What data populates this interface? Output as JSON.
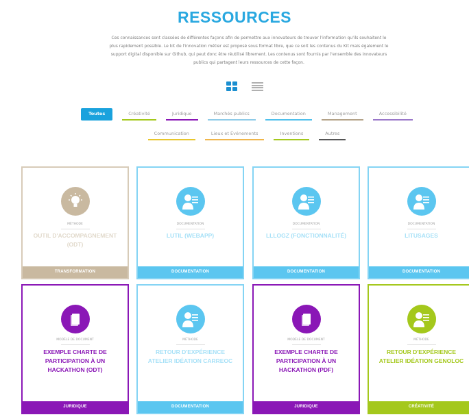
{
  "page": {
    "title": "RESSOURCES",
    "intro": "Ces connaissances sont classées de différentes façons afin de permettre aux innovateurs de trouver l'information qu'ils souhaitent le plus rapidement possible. Le kit de l'innovation métier est proposé sous format libre, que ce soit les contenus du Kit mais également le support digital disponible sur Github, qui peut donc être réutilisé librement. Les contenus sont fournis par l'ensemble des innovateurs publics qui partagent leurs ressources de cette façon."
  },
  "view_toggle": {
    "grid_icon": "grid-view-icon",
    "list_icon": "list-view-icon"
  },
  "filters": [
    {
      "label": "Toutes",
      "active": true,
      "color": "#1aa2dd"
    },
    {
      "label": "Créativité",
      "color": "#a4c81c"
    },
    {
      "label": "Juridique",
      "color": "#8a17b6"
    },
    {
      "label": "Marchés publics",
      "color": "#8ecbe8"
    },
    {
      "label": "Documentation",
      "color": "#4fc0ec"
    },
    {
      "label": "Management",
      "color": "#b3a288"
    },
    {
      "label": "Accessibilité",
      "color": "#9a77c9"
    },
    {
      "label": "Communication",
      "color": "#e8c62c"
    },
    {
      "label": "Lieux et Événements",
      "color": "#f0b64a"
    },
    {
      "label": "Inventions",
      "color": "#a4c81c"
    },
    {
      "label": "Autres",
      "color": "#555555"
    }
  ],
  "cards": [
    {
      "category": "MÉTHODE",
      "title": "OUTIL D'ACCOMPAGNEMENT (ODT)",
      "footer": "TRANSFORMATION",
      "color": "#c9b9a0",
      "icon": "lightbulb-icon",
      "faded": true
    },
    {
      "category": "DOCUMENTATION",
      "title": "LUTIL (WEBAPP)",
      "footer": "DOCUMENTATION",
      "color": "#5bc6f0",
      "icon": "user-document-icon",
      "faded": true
    },
    {
      "category": "DOCUMENTATION",
      "title": "LLLOGZ (FONCTIONNALITÉ)",
      "footer": "DOCUMENTATION",
      "color": "#5bc6f0",
      "icon": "user-document-icon",
      "faded": true
    },
    {
      "category": "DOCUMENTATION",
      "title": "LITUSAGES",
      "footer": "DOCUMENTATION",
      "color": "#5bc6f0",
      "icon": "user-document-icon",
      "faded": true
    },
    {
      "category": "MODÈLE DE DOCUMENT",
      "title": "EXEMPLE CHARTE DE PARTICIPATION À UN HACKATHON (ODT)",
      "footer": "JURIDIQUE",
      "color": "#8a17b6",
      "icon": "document-icon",
      "faded": false
    },
    {
      "category": "MÉTHODE",
      "title": "RETOUR D'EXPÉRIENCE ATELIER IDÉATION CARREOC",
      "footer": "DOCUMENTATION",
      "color": "#5bc6f0",
      "icon": "user-document-icon",
      "faded": true
    },
    {
      "category": "MODÈLE DE DOCUMENT",
      "title": "EXEMPLE CHARTE DE PARTICIPATION À UN HACKATHON (PDF)",
      "footer": "JURIDIQUE",
      "color": "#8a17b6",
      "icon": "document-icon",
      "faded": false
    },
    {
      "category": "MÉTHODE",
      "title": "RETOUR D'EXPÉRIENCE ATELIER IDÉATION GENOLOC",
      "footer": "CRÉATIVITÉ",
      "color": "#a4c81c",
      "icon": "user-document-icon",
      "faded": false
    }
  ]
}
